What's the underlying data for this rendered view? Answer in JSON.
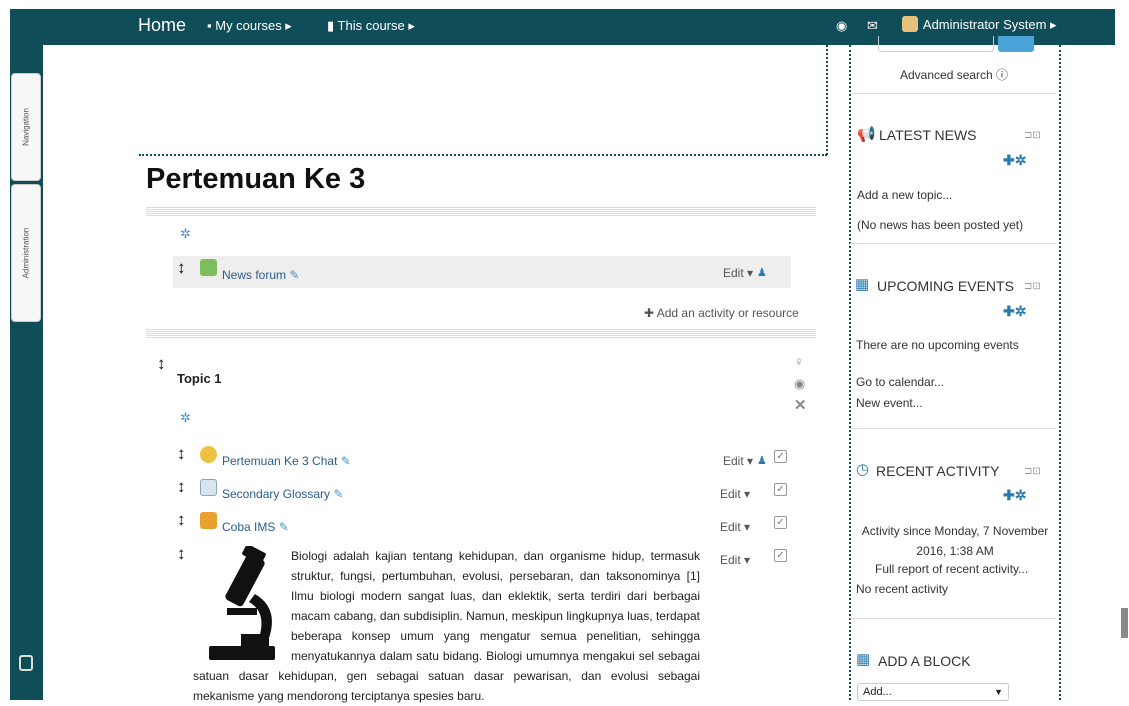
{
  "topbar": {
    "home": "Home",
    "my_courses": "My courses ▸",
    "this_course": "This course ▸",
    "user": "Administrator System ▸"
  },
  "dock": {
    "navigation": "Navigation",
    "administration": "Administration"
  },
  "course": {
    "title": "Pertemuan Ke 3",
    "news_forum": "News forum",
    "edit": "Edit ▾",
    "add_activity": "✚ Add an activity or resource"
  },
  "topic1": {
    "name": "Topic 1",
    "activities": [
      {
        "name": "Pertemuan Ke 3 Chat",
        "edit": "Edit ▾"
      },
      {
        "name": "Secondary Glossary",
        "edit": "Edit ▾"
      },
      {
        "name": "Coba IMS",
        "edit": "Edit ▾"
      }
    ],
    "label_edit": "Edit ▾",
    "label_text": "Biologi adalah kajian tentang kehidupan, dan organisme hidup, termasuk struktur, fungsi, pertumbuhan, evolusi, persebaran, dan taksonominya [1] Ilmu biologi modern sangat luas, dan eklektik, serta terdiri dari berbagai macam cabang, dan subdisiplin. Namun, meskipun lingkupnya luas, terdapat beberapa konsep umum yang mengatur semua penelitian, sehingga menyatukannya dalam satu bidang. Biologi umumnya mengakui sel sebagai satuan dasar kehidupan, gen sebagai satuan dasar pewarisan, dan evolusi sebagai mekanisme yang mendorong terciptanya spesies baru."
  },
  "blocks": {
    "advanced_search": "Advanced search ⓘ",
    "latest_news": {
      "title": "LATEST NEWS",
      "add_topic": "Add a new topic...",
      "empty": "(No news has been posted yet)"
    },
    "upcoming_events": {
      "title": "UPCOMING EVENTS",
      "empty": "There are no upcoming events",
      "go_calendar": "Go to calendar...",
      "new_event": "New event..."
    },
    "recent_activity": {
      "title": "RECENT ACTIVITY",
      "since": "Activity since Monday, 7 November 2016, 1:38 AM",
      "full_report": "Full report of recent activity...",
      "none": "No recent activity"
    },
    "add_block": {
      "title": "ADD A BLOCK",
      "select_value": "Add..."
    }
  }
}
